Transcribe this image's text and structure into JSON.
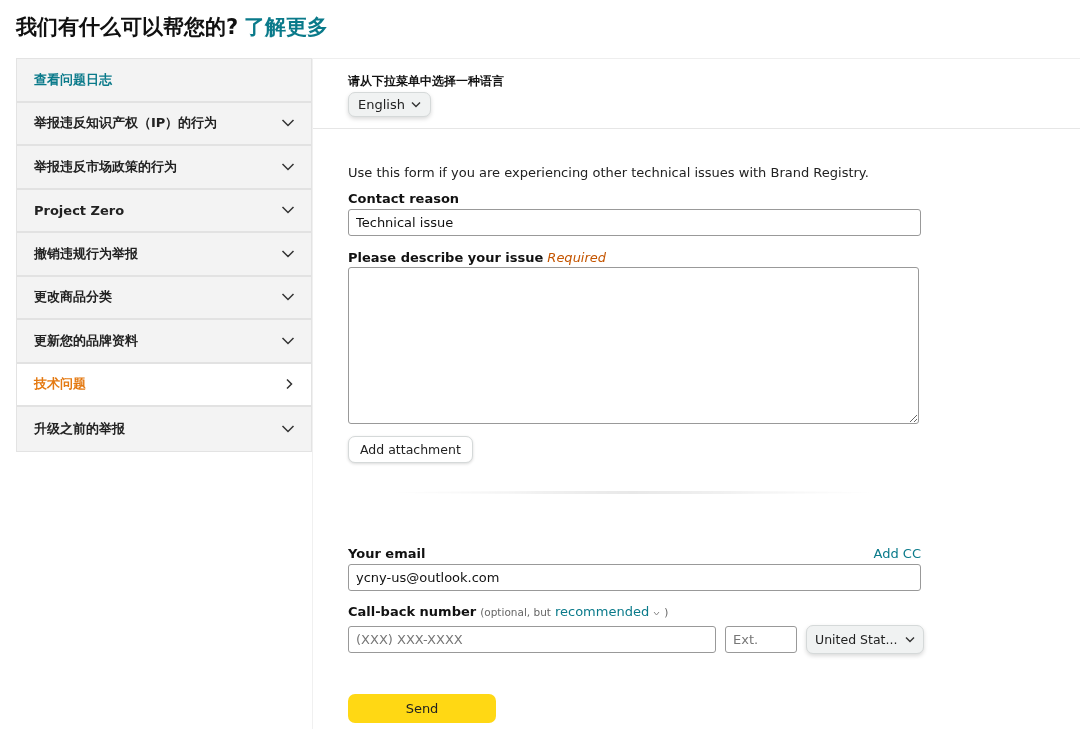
{
  "header": {
    "title": "我们有什么可以帮您的?",
    "link": "了解更多"
  },
  "sidebar": {
    "items": [
      {
        "label": "查看问题日志",
        "kind": "link",
        "selected": false
      },
      {
        "label": "举报违反知识产权（IP）的行为",
        "kind": "section",
        "selected": false
      },
      {
        "label": "举报违反市场政策的行为",
        "kind": "section",
        "selected": false
      },
      {
        "label": "Project Zero",
        "kind": "section",
        "selected": false
      },
      {
        "label": "撤销违规行为举报",
        "kind": "section",
        "selected": false
      },
      {
        "label": "更改商品分类",
        "kind": "section",
        "selected": false
      },
      {
        "label": "更新您的品牌资料",
        "kind": "section",
        "selected": false
      },
      {
        "label": "技术问题",
        "kind": "section",
        "selected": true
      },
      {
        "label": "升级之前的举报",
        "kind": "section",
        "selected": false
      }
    ]
  },
  "language": {
    "label": "请从下拉菜单中选择一种语言",
    "value": "English"
  },
  "form": {
    "intro": "Use this form if you are experiencing other technical issues with Brand Registry.",
    "contact_reason": {
      "label": "Contact reason",
      "value": "Technical issue"
    },
    "description": {
      "label": "Please describe your issue",
      "required": "Required"
    },
    "attachment_button": "Add attachment",
    "email": {
      "label": "Your email",
      "add_cc": "Add CC",
      "value": "ycny-us@outlook.com"
    },
    "callback": {
      "label": "Call-back number",
      "note": "(optional, but",
      "link": "recommended",
      "note_end": ")",
      "phone_placeholder": "(XXX) XXX-XXXX",
      "ext_placeholder": "Ext.",
      "country": "United Stat..."
    },
    "send_button": "Send"
  }
}
